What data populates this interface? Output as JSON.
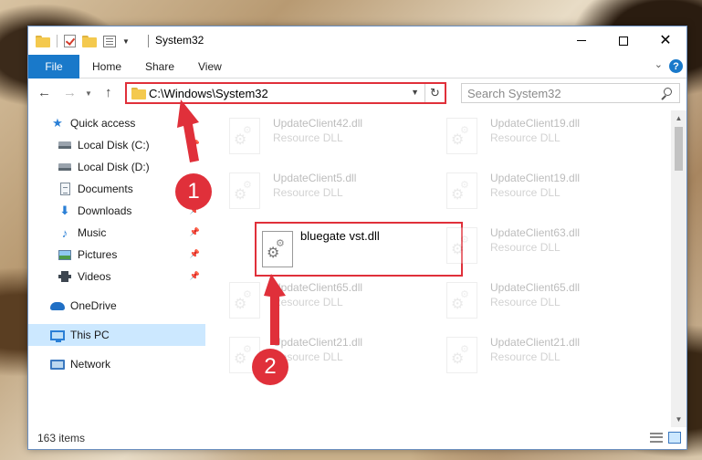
{
  "window": {
    "title": "System32"
  },
  "ribbon": {
    "tabs": {
      "file": "File",
      "home": "Home",
      "share": "Share",
      "view": "View"
    }
  },
  "address": {
    "path": "C:\\Windows\\System32"
  },
  "search": {
    "placeholder": "Search System32"
  },
  "nav": {
    "items": [
      {
        "label": "Quick access",
        "icon": "star-icon"
      },
      {
        "label": "Local Disk (C:)",
        "icon": "disk-icon",
        "pinned": true
      },
      {
        "label": "Local Disk (D:)",
        "icon": "disk-icon"
      },
      {
        "label": "Documents",
        "icon": "documents-icon",
        "pinned": true
      },
      {
        "label": "Downloads",
        "icon": "downloads-icon",
        "pinned": true
      },
      {
        "label": "Music",
        "icon": "music-icon",
        "pinned": true
      },
      {
        "label": "Pictures",
        "icon": "pictures-icon",
        "pinned": true
      },
      {
        "label": "Videos",
        "icon": "videos-icon",
        "pinned": true
      },
      {
        "label": "OneDrive",
        "icon": "onedrive-icon"
      },
      {
        "label": "This PC",
        "icon": "this-pc-icon",
        "selected": true
      },
      {
        "label": "Network",
        "icon": "network-icon"
      }
    ]
  },
  "files": {
    "type_label": "Resource DLL",
    "items": [
      {
        "name": "UpdateClient42.dll"
      },
      {
        "name": "UpdateClient19.dll"
      },
      {
        "name": "UpdateClient5.dll"
      },
      {
        "name": "UpdateClient19.dll"
      },
      {
        "name": "bluegate vst.dll"
      },
      {
        "name": "UpdateClient63.dll"
      },
      {
        "name": "UpdateClient65.dll"
      },
      {
        "name": "UpdateClient65.dll"
      },
      {
        "name": "UpdateClient21.dll"
      },
      {
        "name": "UpdateClient21.dll"
      }
    ]
  },
  "status": {
    "count": "163 items"
  },
  "callouts": {
    "first": "1",
    "second": "2"
  },
  "colors": {
    "accent": "#1979ca",
    "highlight": "#e0303a",
    "selected_bg": "#cce8ff"
  }
}
